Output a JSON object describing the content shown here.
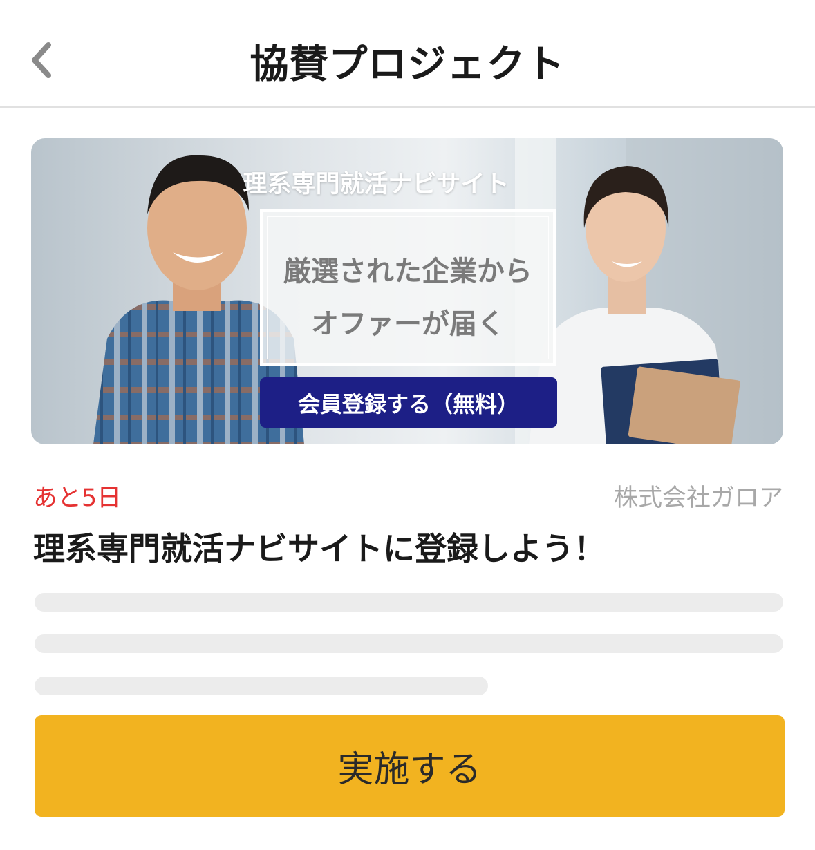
{
  "header": {
    "title": "協賛プロジェクト",
    "back_icon": "chevron-left-icon"
  },
  "banner": {
    "subtitle": "理系専門就活ナビサイト",
    "catch_line1": "厳選された企業から",
    "catch_line2": "オファーが届く",
    "cta_label": "会員登録する（無料）",
    "cta_color": "#1d1f86"
  },
  "project": {
    "deadline": "あと5日",
    "deadline_color": "#e53232",
    "company": "株式会社ガロア",
    "title": "理系専門就活ナビサイトに登録しよう！"
  },
  "action": {
    "label": "実施する",
    "color": "#f2b320"
  }
}
